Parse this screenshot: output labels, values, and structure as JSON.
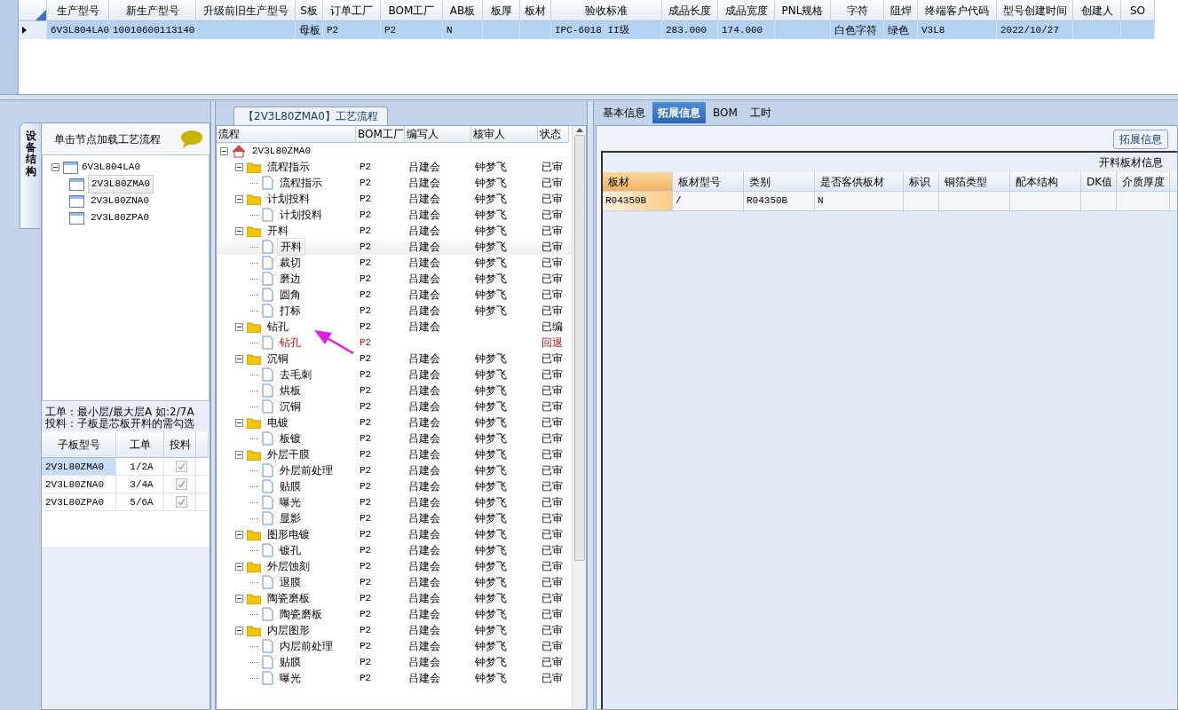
{
  "top_grid": {
    "columns": [
      "生产型号",
      "新生产型号",
      "升级前旧生产型号",
      "S板",
      "订单工厂",
      "BOM工厂",
      "AB板",
      "板厚",
      "板材",
      "验收标准",
      "成品长度",
      "成品宽度",
      "PNL规格",
      "字符",
      "阻焊",
      "终端客户代码",
      "型号创建时间",
      "创建人",
      "SO"
    ],
    "rows": [
      {
        "selected": true,
        "cells": [
          "6V3L804LA0",
          "10010600113140",
          null,
          "母板",
          "P2",
          "P2",
          "N",
          null,
          null,
          "IPC-6018 II级",
          "283.000",
          "174.000",
          null,
          "白色字符",
          "绿色",
          "V3L8",
          "2022/10/27",
          null,
          null
        ]
      }
    ]
  },
  "side_tab": {
    "label": "设备结构"
  },
  "structure": {
    "title": "单击节点加载工艺流程",
    "tree": {
      "label": "6V3L804LA0",
      "expanded": true,
      "selected": false,
      "children": [
        {
          "label": "2V3L80ZMA0",
          "selected": true
        },
        {
          "label": "2V3L80ZNA0",
          "selected": false
        },
        {
          "label": "2V3L80ZPA0",
          "selected": false
        }
      ]
    },
    "note_lines": [
      "工单：最小层/最大层A 如:2/7A",
      "投料：子板是芯板开料的需勾选"
    ],
    "sub_table": {
      "columns": [
        "子板型号",
        "工单",
        "投料"
      ],
      "rows": [
        {
          "board": "2V3L80ZMA0",
          "order": "1/2A",
          "feed": true,
          "selected": true
        },
        {
          "board": "2V3L80ZNA0",
          "order": "3/4A",
          "feed": true,
          "selected": false
        },
        {
          "board": "2V3L80ZPA0",
          "order": "5/6A",
          "feed": true,
          "selected": false
        }
      ]
    }
  },
  "flow": {
    "title": "【2V3L80ZMA0】工艺流程",
    "columns": [
      "流程",
      "BOM工厂",
      "编写人",
      "核审人",
      "状态"
    ],
    "root": {
      "label": "2V3L80ZMA0",
      "expanded": true,
      "selected": false,
      "children": [
        {
          "label": "流程指示",
          "bom": "P2",
          "writer": "吕建会",
          "reviewer": "钟梦飞",
          "status": "已审",
          "returned": false,
          "selected": false,
          "expanded": true,
          "children": [
            {
              "label": "流程指示",
              "bom": "P2",
              "writer": "吕建会",
              "reviewer": "钟梦飞",
              "status": "已审",
              "returned": false,
              "selected": false
            }
          ]
        },
        {
          "label": "计划投料",
          "bom": "P2",
          "writer": "吕建会",
          "reviewer": "钟梦飞",
          "status": "已审",
          "returned": false,
          "selected": false,
          "expanded": true,
          "children": [
            {
              "label": "计划投料",
              "bom": "P2",
              "writer": "吕建会",
              "reviewer": "钟梦飞",
              "status": "已审",
              "returned": false,
              "selected": false
            }
          ]
        },
        {
          "label": "开料",
          "bom": "P2",
          "writer": "吕建会",
          "reviewer": "钟梦飞",
          "status": "已审",
          "returned": false,
          "selected": false,
          "expanded": true,
          "children": [
            {
              "label": "开料",
              "bom": "P2",
              "writer": "吕建会",
              "reviewer": "钟梦飞",
              "status": "已审",
              "returned": false,
              "selected": true
            },
            {
              "label": "裁切",
              "bom": "P2",
              "writer": "吕建会",
              "reviewer": "钟梦飞",
              "status": "已审",
              "returned": false,
              "selected": false
            },
            {
              "label": "磨边",
              "bom": "P2",
              "writer": "吕建会",
              "reviewer": "钟梦飞",
              "status": "已审",
              "returned": false,
              "selected": false
            },
            {
              "label": "圆角",
              "bom": "P2",
              "writer": "吕建会",
              "reviewer": "钟梦飞",
              "status": "已审",
              "returned": false,
              "selected": false
            },
            {
              "label": "打标",
              "bom": "P2",
              "writer": "吕建会",
              "reviewer": "钟梦飞",
              "status": "已审",
              "returned": false,
              "selected": false
            }
          ]
        },
        {
          "label": "钻孔",
          "bom": "P2",
          "writer": "吕建会",
          "status": "已编",
          "returned": false,
          "selected": false,
          "expanded": true,
          "children": [
            {
              "label": "钻孔",
              "bom": "P2",
              "status": "回退",
              "returned": true,
              "selected": false
            }
          ]
        },
        {
          "label": "沉铜",
          "bom": "P2",
          "writer": "吕建会",
          "reviewer": "钟梦飞",
          "status": "已审",
          "returned": false,
          "selected": false,
          "expanded": true,
          "children": [
            {
              "label": "去毛刺",
              "bom": "P2",
              "writer": "吕建会",
              "reviewer": "钟梦飞",
              "status": "已审",
              "returned": false,
              "selected": false
            },
            {
              "label": "烘板",
              "bom": "P2",
              "writer": "吕建会",
              "reviewer": "钟梦飞",
              "status": "已审",
              "returned": false,
              "selected": false
            },
            {
              "label": "沉铜",
              "bom": "P2",
              "writer": "吕建会",
              "reviewer": "钟梦飞",
              "status": "已审",
              "returned": false,
              "selected": false
            }
          ]
        },
        {
          "label": "电镀",
          "bom": "P2",
          "writer": "吕建会",
          "reviewer": "钟梦飞",
          "status": "已审",
          "returned": false,
          "selected": false,
          "expanded": true,
          "children": [
            {
              "label": "板镀",
              "bom": "P2",
              "writer": "吕建会",
              "reviewer": "钟梦飞",
              "status": "已审",
              "returned": false,
              "selected": false
            }
          ]
        },
        {
          "label": "外层干膜",
          "bom": "P2",
          "writer": "吕建会",
          "reviewer": "钟梦飞",
          "status": "已审",
          "returned": false,
          "selected": false,
          "expanded": true,
          "children": [
            {
              "label": "外层前处理",
              "bom": "P2",
              "writer": "吕建会",
              "reviewer": "钟梦飞",
              "status": "已审",
              "returned": false,
              "selected": false
            },
            {
              "label": "贴膜",
              "bom": "P2",
              "writer": "吕建会",
              "reviewer": "钟梦飞",
              "status": "已审",
              "returned": false,
              "selected": false
            },
            {
              "label": "曝光",
              "bom": "P2",
              "writer": "吕建会",
              "reviewer": "钟梦飞",
              "status": "已审",
              "returned": false,
              "selected": false
            },
            {
              "label": "显影",
              "bom": "P2",
              "writer": "吕建会",
              "reviewer": "钟梦飞",
              "status": "已审",
              "returned": false,
              "selected": false
            }
          ]
        },
        {
          "label": "图形电镀",
          "bom": "P2",
          "writer": "吕建会",
          "reviewer": "钟梦飞",
          "status": "已审",
          "returned": false,
          "selected": false,
          "expanded": true,
          "children": [
            {
              "label": "镀孔",
              "bom": "P2",
              "writer": "吕建会",
              "reviewer": "钟梦飞",
              "status": "已审",
              "returned": false,
              "selected": false
            }
          ]
        },
        {
          "label": "外层蚀刻",
          "bom": "P2",
          "writer": "吕建会",
          "reviewer": "钟梦飞",
          "status": "已审",
          "returned": false,
          "selected": false,
          "expanded": true,
          "children": [
            {
              "label": "退膜",
              "bom": "P2",
              "writer": "吕建会",
              "reviewer": "钟梦飞",
              "status": "已审",
              "returned": false,
              "selected": false
            }
          ]
        },
        {
          "label": "陶瓷磨板",
          "bom": "P2",
          "writer": "吕建会",
          "reviewer": "钟梦飞",
          "status": "已审",
          "returned": false,
          "selected": false,
          "expanded": true,
          "children": [
            {
              "label": "陶瓷磨板",
              "bom": "P2",
              "writer": "吕建会",
              "reviewer": "钟梦飞",
              "status": "已审",
              "returned": false,
              "selected": false
            }
          ]
        },
        {
          "label": "内层图形",
          "bom": "P2",
          "writer": "吕建会",
          "reviewer": "钟梦飞",
          "status": "已审",
          "returned": false,
          "selected": false,
          "expanded": true,
          "children": [
            {
              "label": "内层前处理",
              "bom": "P2",
              "writer": "吕建会",
              "reviewer": "钟梦飞",
              "status": "已审",
              "returned": false,
              "selected": false
            },
            {
              "label": "贴膜",
              "bom": "P2",
              "writer": "吕建会",
              "reviewer": "钟梦飞",
              "status": "已审",
              "returned": false,
              "selected": false
            },
            {
              "label": "曝光",
              "bom": "P2",
              "writer": "吕建会",
              "reviewer": "钟梦飞",
              "status": "已审",
              "returned": false,
              "selected": false
            }
          ]
        }
      ]
    }
  },
  "detail": {
    "tabs": [
      {
        "label": "基本信息",
        "selected": false
      },
      {
        "label": "拓展信息",
        "selected": true
      },
      {
        "label": "BOM",
        "selected": false
      },
      {
        "label": "工时",
        "selected": false
      }
    ],
    "group_title": "拓展信息",
    "table_title": "开料板材信息",
    "columns": [
      "板材",
      "板材型号",
      "类别",
      "是否客供板材",
      "标识",
      "铜箔类型",
      "配本结构",
      "DK值",
      "介质厚度"
    ],
    "rows": [
      {
        "selected": true,
        "cells": [
          "R04350B",
          "/",
          "R04350B",
          "N",
          null,
          null,
          null,
          null,
          null
        ]
      }
    ]
  }
}
